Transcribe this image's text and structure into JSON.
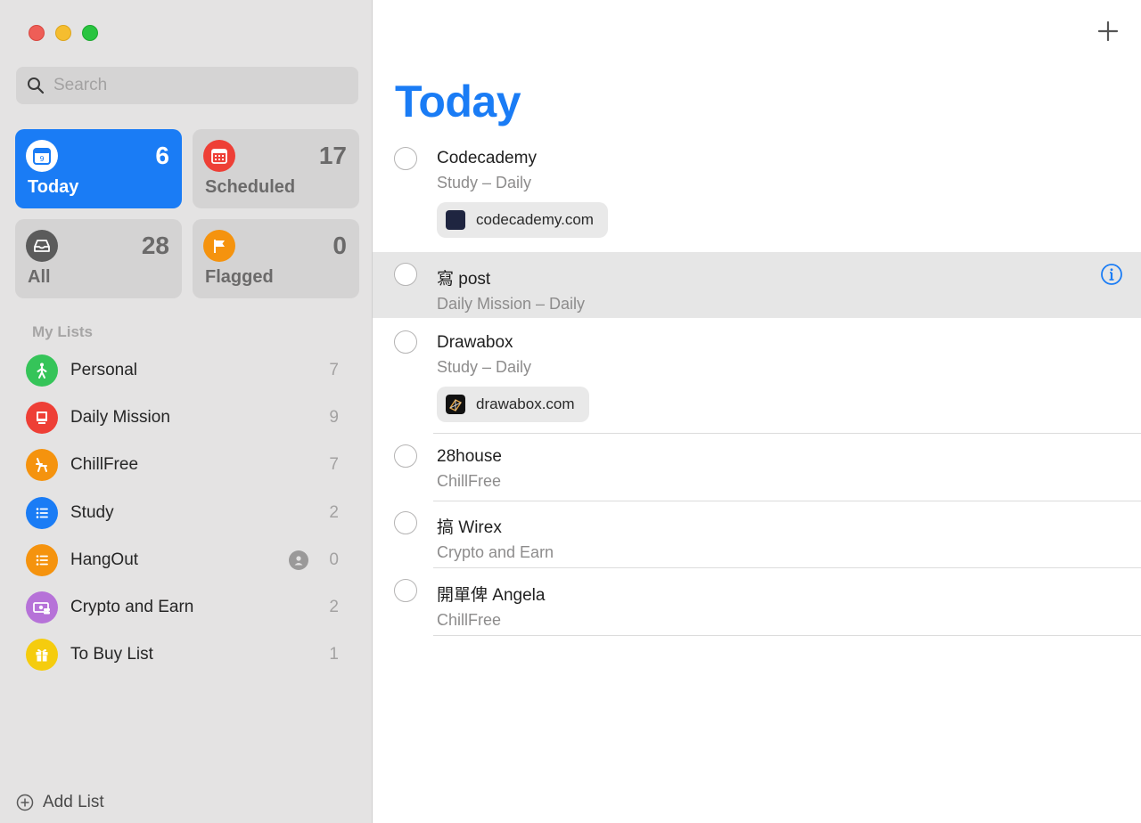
{
  "sidebar": {
    "search": {
      "placeholder": "Search"
    },
    "smart_lists": [
      {
        "label": "Today",
        "count": "6",
        "icon": "calendar-today-icon",
        "color": "#1a7cf5",
        "active": true
      },
      {
        "label": "Scheduled",
        "count": "17",
        "icon": "calendar-grid-icon",
        "color": "#ee3f36",
        "active": false
      },
      {
        "label": "All",
        "count": "28",
        "icon": "tray-icon",
        "color": "#5b5b5b",
        "active": false
      },
      {
        "label": "Flagged",
        "count": "0",
        "icon": "flag-icon",
        "color": "#f5930e",
        "active": false
      }
    ],
    "my_lists_title": "My Lists",
    "lists": [
      {
        "name": "Personal",
        "count": "7",
        "icon": "person-walking-icon",
        "color": "#35c459"
      },
      {
        "name": "Daily Mission",
        "count": "9",
        "icon": "monitor-icon",
        "color": "#ee3f36"
      },
      {
        "name": "ChillFree",
        "count": "7",
        "icon": "chair-icon",
        "color": "#f5930e"
      },
      {
        "name": "Study",
        "count": "2",
        "icon": "list-bullet-icon",
        "color": "#1a7cf5"
      },
      {
        "name": "HangOut",
        "count": "0",
        "icon": "list-bullet-icon",
        "color": "#f5930e",
        "shared": true
      },
      {
        "name": "Crypto and Earn",
        "count": "2",
        "icon": "money-icon",
        "color": "#b672d8"
      },
      {
        "name": "To Buy List",
        "count": "1",
        "icon": "gift-icon",
        "color": "#f5cc0e"
      }
    ],
    "add_list_label": "Add List"
  },
  "main": {
    "title": "Today",
    "tasks": [
      {
        "title": "Codecademy",
        "subtitle": "Study – Daily",
        "link": "codecademy.com",
        "selected": false
      },
      {
        "title": "寫 post",
        "subtitle": "Daily Mission – Daily",
        "selected": true
      },
      {
        "title": "Drawabox",
        "subtitle": "Study – Daily",
        "link": "drawabox.com",
        "selected": false
      },
      {
        "title": "28house",
        "subtitle": "ChillFree",
        "selected": false
      },
      {
        "title": "搞 Wirex",
        "subtitle": "Crypto and Earn",
        "selected": false
      },
      {
        "title": "開單俾 Angela",
        "subtitle": "ChillFree",
        "selected": false
      }
    ]
  },
  "colors": {
    "accent": "#1a7cf5",
    "sidebar_bg": "#e4e3e3"
  }
}
